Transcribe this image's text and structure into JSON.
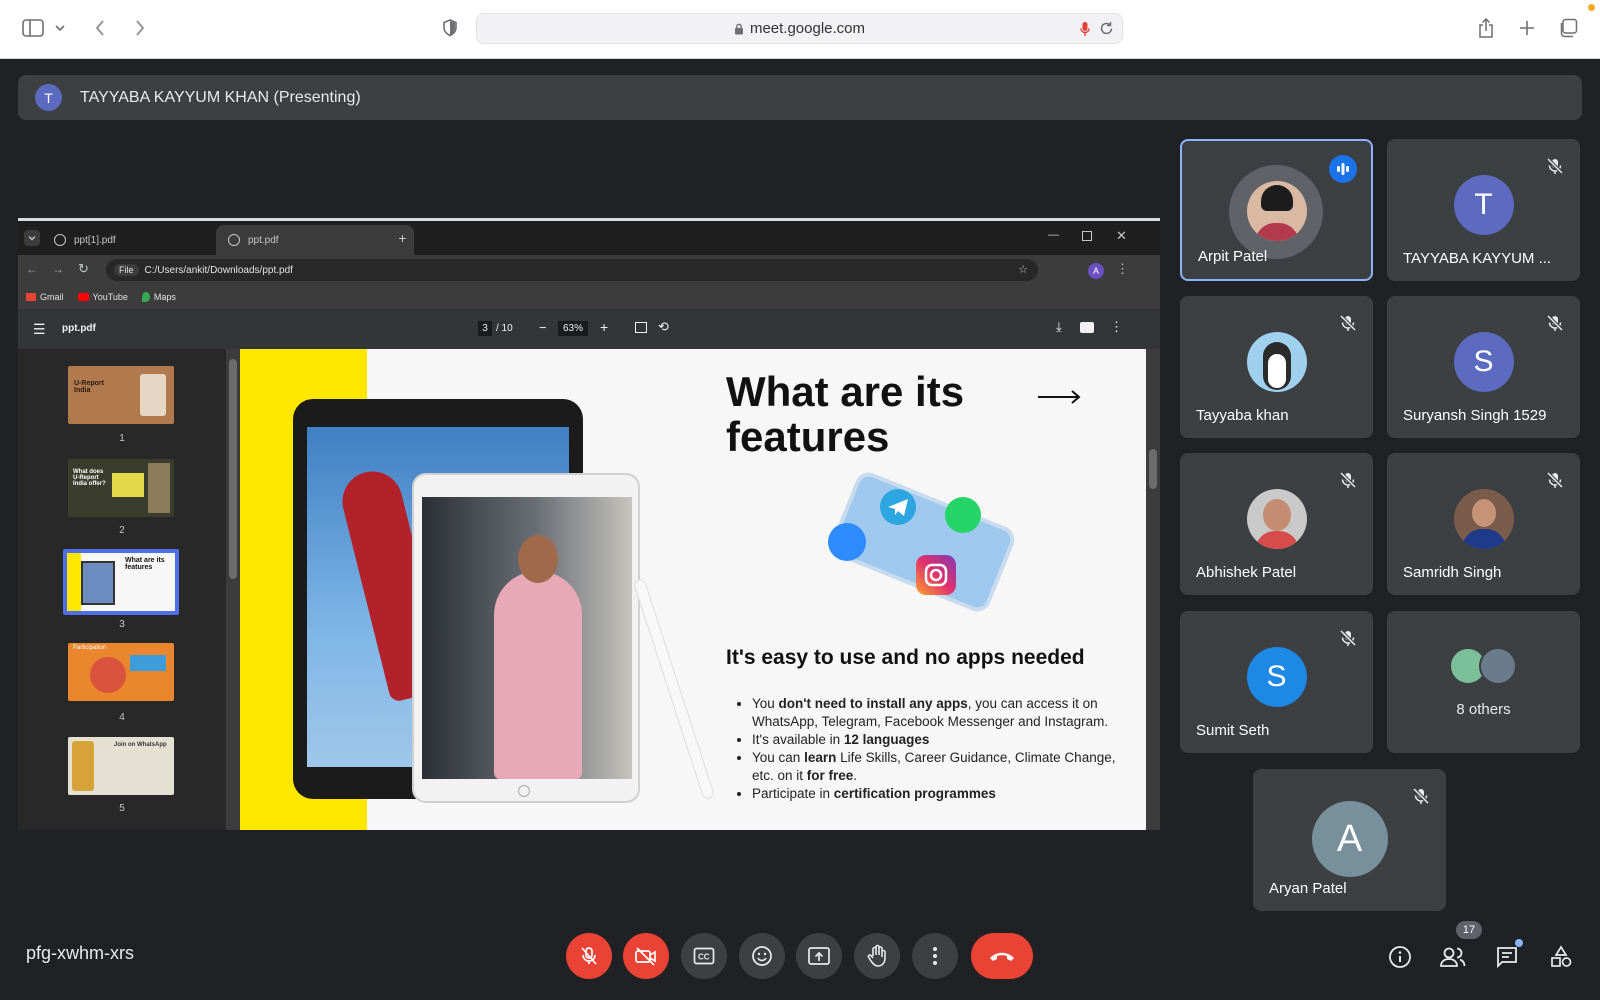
{
  "browser": {
    "url": "meet.google.com"
  },
  "presenter_bar": {
    "avatar_letter": "T",
    "label": "TAYYABA KAYYUM KHAN (Presenting)"
  },
  "shared_screen": {
    "tabs": [
      {
        "label": "ppt[1].pdf"
      },
      {
        "label": "ppt.pdf"
      }
    ],
    "file_chip": "File",
    "address": "C:/Users/ankit/Downloads/ppt.pdf",
    "profile_letter": "A",
    "bookmarks": [
      {
        "label": "Gmail"
      },
      {
        "label": "YouTube"
      },
      {
        "label": "Maps"
      }
    ],
    "pdf": {
      "filename": "ppt.pdf",
      "page_current": "3",
      "page_total": "/ 10",
      "zoom": "63%",
      "thumbnails": [
        "1",
        "2",
        "3",
        "4",
        "5"
      ],
      "thumb_texts": [
        "U-Report India",
        "What does U-Report India offer?",
        "What are its features",
        "Participation",
        "Join on WhatsApp"
      ]
    },
    "slide": {
      "title": "What are its features",
      "subtitle": "It's easy to use and no apps needed",
      "bullets": [
        {
          "a": "You ",
          "b": "don't need to install any apps",
          "c": ", you can access it on WhatsApp, Telegram, Facebook Messenger and Instagram."
        },
        {
          "a": "It's available in ",
          "b": "12 languages",
          "c": ""
        },
        {
          "a": "You can ",
          "b": "learn",
          "c": " Life Skills, Career Guidance, Climate Change, etc. on it ",
          "d": "for free",
          "e": "."
        },
        {
          "a": "Participate in ",
          "b": "certification programmes",
          "c": ""
        }
      ]
    }
  },
  "participants": [
    {
      "name": "Arpit Patel",
      "state": "speaking"
    },
    {
      "name": "TAYYABA KAYYUM ...",
      "letter": "T",
      "color": "#5c6bc0"
    },
    {
      "name": "Tayyaba khan"
    },
    {
      "name": "Suryansh Singh 1529",
      "letter": "S",
      "color": "#5c6bc0"
    },
    {
      "name": "Abhishek Patel"
    },
    {
      "name": "Samridh Singh"
    },
    {
      "name": "Sumit Seth",
      "letter": "S",
      "color": "#1e88e5"
    },
    {
      "name": "8 others"
    },
    {
      "name": "Aryan Patel",
      "letter": "A",
      "color": "#78909c"
    }
  ],
  "meeting": {
    "code": "pfg-xwhm-xrs",
    "people_count": "17"
  },
  "colors": {
    "background": "#202124",
    "tile": "#3c4043",
    "danger": "#ea4335",
    "active_border": "#8ab4f8",
    "slide_yellow": "#ffe800"
  }
}
